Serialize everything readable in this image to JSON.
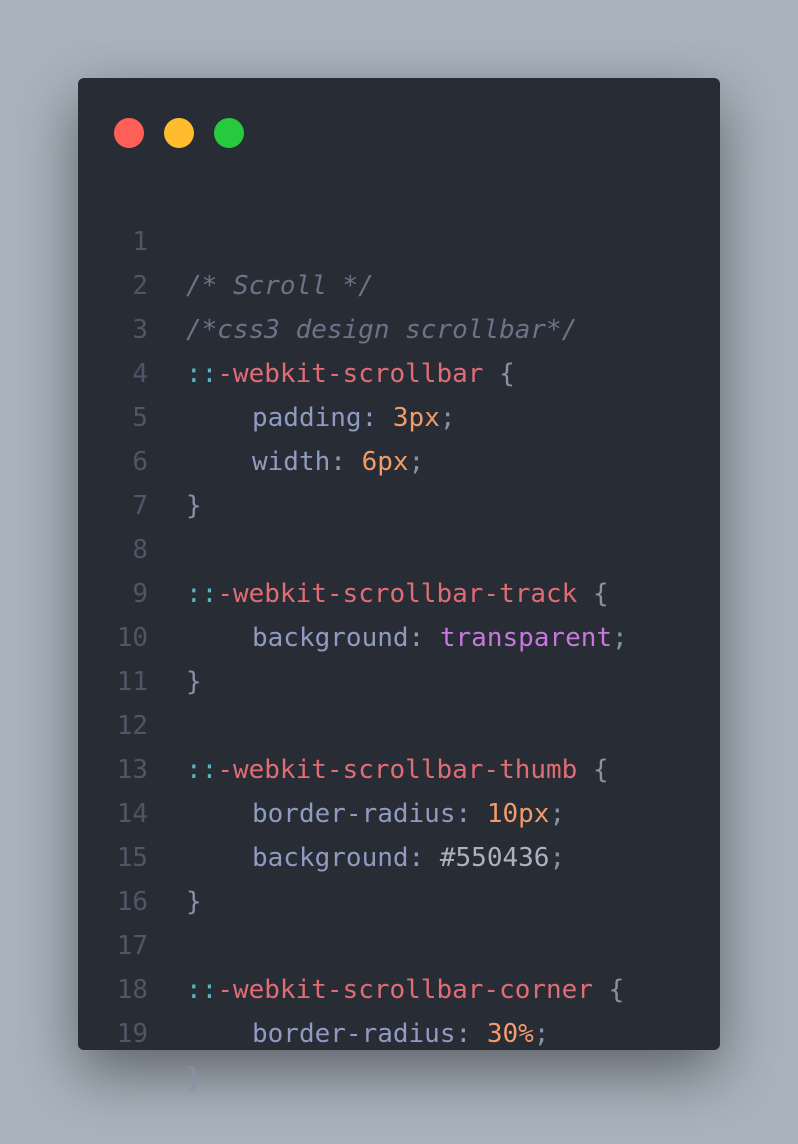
{
  "window": {
    "dots": {
      "red": "#ff5f56",
      "yellow": "#ffbd2e",
      "green": "#27c93f"
    }
  },
  "code": {
    "line_numbers": [
      "1",
      "2",
      "3",
      "4",
      "5",
      "6",
      "7",
      "8",
      "9",
      "10",
      "11",
      "12",
      "13",
      "14",
      "15",
      "16",
      "17",
      "18",
      "19"
    ],
    "lines": {
      "l1": {
        "comment": "/* Scroll */"
      },
      "l2": {
        "comment": "/*css3 design scrollbar*/"
      },
      "l3": {
        "colons": "::",
        "selector": "-webkit-scrollbar",
        "brace": "{"
      },
      "l4": {
        "prop": "padding",
        "sep": ":",
        "value": "3px",
        "end": ";"
      },
      "l5": {
        "prop": "width",
        "sep": ":",
        "value": "6px",
        "end": ";"
      },
      "l6": {
        "brace": "}"
      },
      "l8": {
        "colons": "::",
        "selector": "-webkit-scrollbar-track",
        "brace": "{"
      },
      "l9": {
        "prop": "background",
        "sep": ":",
        "value": "transparent",
        "end": ";"
      },
      "l10": {
        "brace": "}"
      },
      "l12": {
        "colons": "::",
        "selector": "-webkit-scrollbar-thumb",
        "brace": "{"
      },
      "l13": {
        "prop": "border-radius",
        "sep": ":",
        "value": "10px",
        "end": ";"
      },
      "l14": {
        "prop": "background",
        "sep": ":",
        "value": "#550436",
        "end": ";"
      },
      "l15": {
        "brace": "}"
      },
      "l17": {
        "colons": "::",
        "selector": "-webkit-scrollbar-corner",
        "brace": "{"
      },
      "l18": {
        "prop": "border-radius",
        "sep": ":",
        "value": "30%",
        "end": ";"
      },
      "l19": {
        "brace": "}"
      }
    }
  },
  "colors": {
    "background": "#a9b3bd",
    "editor": "#282c34",
    "comment": "#6b7389",
    "selector": "#e06c75",
    "pseudo_colons": "#56b6c2",
    "property": "#8f9bc0",
    "number": "#f39a6b",
    "keyword": "#c678dd"
  }
}
